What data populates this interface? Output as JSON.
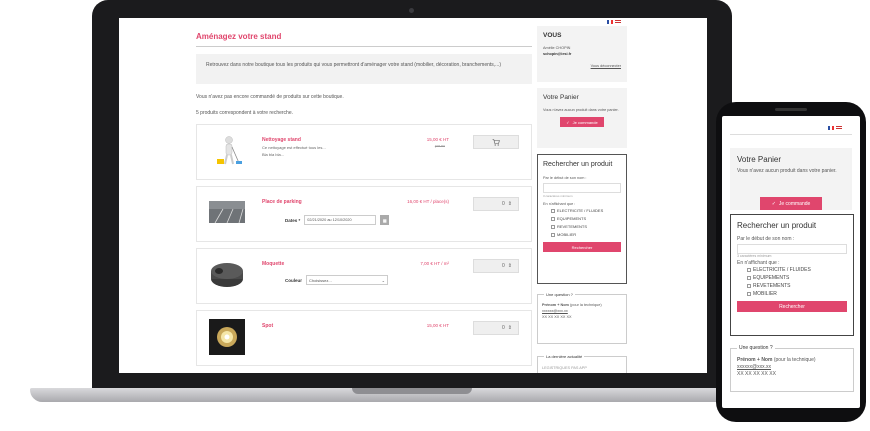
{
  "laptop": {
    "page_title": "Aménagez votre stand",
    "intro": "Retrouvez dans notre boutique tous les produits qui vous permettront d'aménager votre stand (mobilier, décoration, branchements,...)",
    "info_no_order": "Vous n'avez pas encore commandé de produits sur cette boutique.",
    "info_count": "5 produits correspondent à votre recherche.",
    "products": [
      {
        "name": "Nettoyage stand",
        "desc1": "Ce nettoyage est effectué tous les...",
        "desc2": "Bla bla bla...",
        "price": "15,00 € HT",
        "old_price": "par m²",
        "qty": "",
        "kind": "cart"
      },
      {
        "name": "Place de parking",
        "price": "16,00 € HT / place(s)",
        "dates_label": "Dates *",
        "dates_value": "02/21/2020 au 12/10/2020",
        "qty": "0",
        "kind": "dates"
      },
      {
        "name": "Moquette",
        "price": "7,00 € HT / m²",
        "color_label": "Couleur",
        "color_value": "Choisissez...",
        "qty": "0",
        "kind": "color"
      },
      {
        "name": "Spot",
        "price": "15,00 € HT",
        "qty": "0",
        "kind": "plain"
      }
    ],
    "sidebar": {
      "user_title": "VOUS",
      "user_name": "Amélie CHOPIN",
      "user_email": "schopin@iesi.fr",
      "logout": "Vous déconnecter",
      "cart_title": "Votre Panier",
      "cart_empty": "Vous n'avez aucun produit dans votre panier.",
      "order_button": "Je commande",
      "search_title": "Rechercher un produit",
      "search_label": "Par le début de son nom :",
      "search_placeholder": "",
      "search_hint": "3 caractères minimum",
      "filter_label": "En n'affichant que :",
      "categories": [
        "ELECTRICITE / FLUIDES",
        "EQUIPEMENTS",
        "REVETEMENTS",
        "MOBILIER"
      ],
      "search_button": "Rechercher",
      "question_legend": "Une question ?",
      "question_name": "Prénom + Nom",
      "question_role": "(pour la technique)",
      "question_email": "xxxxxx@xxx.xx",
      "question_phone": "XX XX XX XX XX",
      "news_legend": "La dernière actualité",
      "news_text": "LEGISTRIQUES PAS APP"
    }
  },
  "phone": {
    "cart_title": "Votre Panier",
    "cart_empty": "Vous n'avez aucun produit dans votre panier.",
    "order_button": "Je commande",
    "search_title": "Rechercher un produit",
    "search_label": "Par le début de son nom :",
    "search_hint": "3 caractères minimum",
    "filter_label": "En n'affichant que :",
    "categories": [
      "ELECTRICITE / FLUIDES",
      "EQUIPEMENTS",
      "REVETEMENTS",
      "MOBILIER"
    ],
    "search_button": "Rechercher",
    "question_legend": "Une question ?",
    "question_name": "Prénom + Nom",
    "question_role": "(pour la technique)",
    "question_email": "xxxxxx@xxx.xx",
    "question_phone": "XX XX XX XX XX"
  },
  "colors": {
    "accent": "#e0466d",
    "laptop_frame": "#1b1b1d",
    "panel": "#f3f3f3"
  },
  "icons": {
    "cart": "cart-icon",
    "check": "check-circle-icon",
    "dropdown": "chevron-down-icon",
    "calendar": "calendar-icon"
  }
}
